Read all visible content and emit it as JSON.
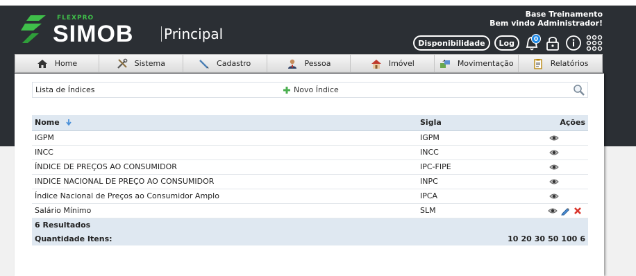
{
  "brand": {
    "tag": "FLEXPRO",
    "name": "SIMOB",
    "section": "Principal",
    "color": "#3fbf4a"
  },
  "user": {
    "line1": "Base Treinamento",
    "line2": "Bem vindo Administrador!"
  },
  "toolbar": {
    "disponibilidade": "Disponibilidade",
    "log": "Log",
    "notifications_count": "0",
    "icons": [
      "bell-icon",
      "lock-icon",
      "info-icon",
      "apps-grid-icon"
    ]
  },
  "menu": [
    {
      "label": "Home",
      "icon": "home-icon"
    },
    {
      "label": "Sistema",
      "icon": "tools-icon"
    },
    {
      "label": "Cadastro",
      "icon": "pen-icon"
    },
    {
      "label": "Pessoa",
      "icon": "person-icon"
    },
    {
      "label": "Imóvel",
      "icon": "house-icon"
    },
    {
      "label": "Movimentação",
      "icon": "transfer-icon"
    },
    {
      "label": "Relatórios",
      "icon": "report-icon"
    }
  ],
  "list": {
    "title": "Lista de Índices",
    "new_label": "Novo Índice"
  },
  "table": {
    "headers": {
      "nome": "Nome",
      "sigla": "Sigla",
      "acoes": "Ações"
    },
    "rows": [
      {
        "nome": "IGPM",
        "sigla": "IGPM",
        "actions": [
          "view"
        ]
      },
      {
        "nome": "INCC",
        "sigla": "INCC",
        "actions": [
          "view"
        ]
      },
      {
        "nome": "ÍNDICE DE PREÇOS AO CONSUMIDOR",
        "sigla": "IPC-FIPE",
        "actions": [
          "view"
        ]
      },
      {
        "nome": "INDICE NACIONAL DE PREÇO AO CONSUMIDOR",
        "sigla": "INPC",
        "actions": [
          "view"
        ]
      },
      {
        "nome": "Índice Nacional de Preços ao Consumidor Amplo",
        "sigla": "IPCA",
        "actions": [
          "view"
        ]
      },
      {
        "nome": "Salário Mínimo",
        "sigla": "SLM",
        "actions": [
          "view",
          "edit",
          "delete"
        ]
      }
    ],
    "results": "6 Resultados",
    "quantity_label": "Quantidade Itens:",
    "page_sizes": [
      "10",
      "20",
      "30",
      "50",
      "100",
      "6"
    ]
  }
}
